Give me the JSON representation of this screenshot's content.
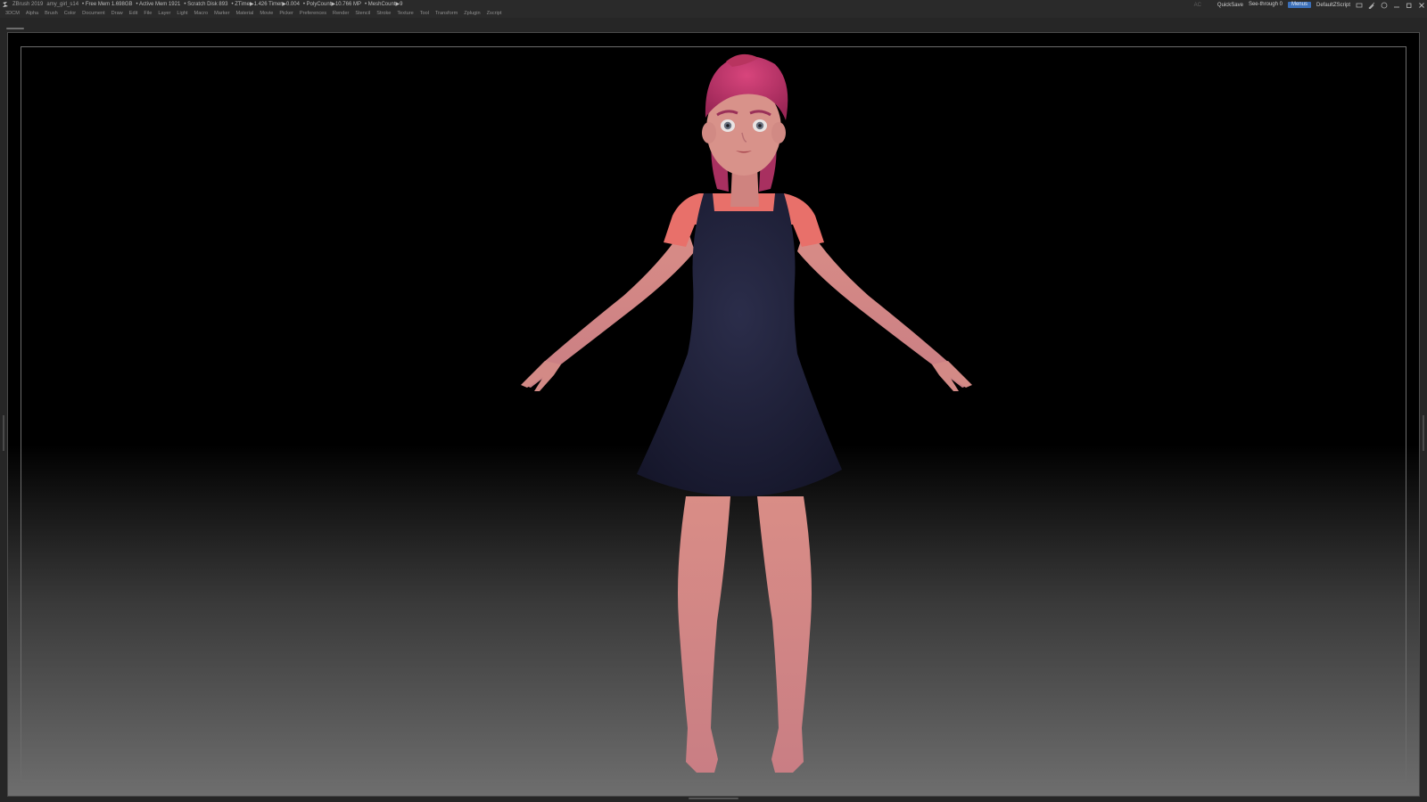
{
  "titlebar": {
    "app_title": "ZBrush 2019",
    "document_name": "amy_girl_s14",
    "stats": [
      "• Free Mem 1.698GB",
      "• Active Mem 1921",
      "• Scratch Disk 893",
      "• ZTime▶1.426 Timer▶0.004",
      "• PolyCount▶10.766 MP",
      "• MeshCount▶9"
    ],
    "ac_label": "AC",
    "quicksave_label": "QuickSave",
    "see_through_label": "See-through   0",
    "see_through_value": 0,
    "menus_label": "Menus",
    "script_label": "DefaultZScript"
  },
  "menubar": {
    "items": [
      "3DCM",
      "Alpha",
      "Brush",
      "Color",
      "Document",
      "Draw",
      "Edit",
      "File",
      "Layer",
      "Light",
      "Macro",
      "Marker",
      "Material",
      "Movie",
      "Picker",
      "Preferences",
      "Render",
      "Stencil",
      "Stroke",
      "Texture",
      "Tool",
      "Transform",
      "Zplugin",
      "Zscript"
    ]
  },
  "icons": {
    "app": "zbrush-logo-icon",
    "window_controls": [
      "layout-icon",
      "brush-icon",
      "help-icon",
      "minimize-icon",
      "restore-icon",
      "close-icon"
    ]
  },
  "colors": {
    "menus_button": "#3b6fb8",
    "hair": "#c43a6e",
    "skin": "#d58b84",
    "dress": "#1e1f36",
    "shirt": "#e8706a"
  }
}
